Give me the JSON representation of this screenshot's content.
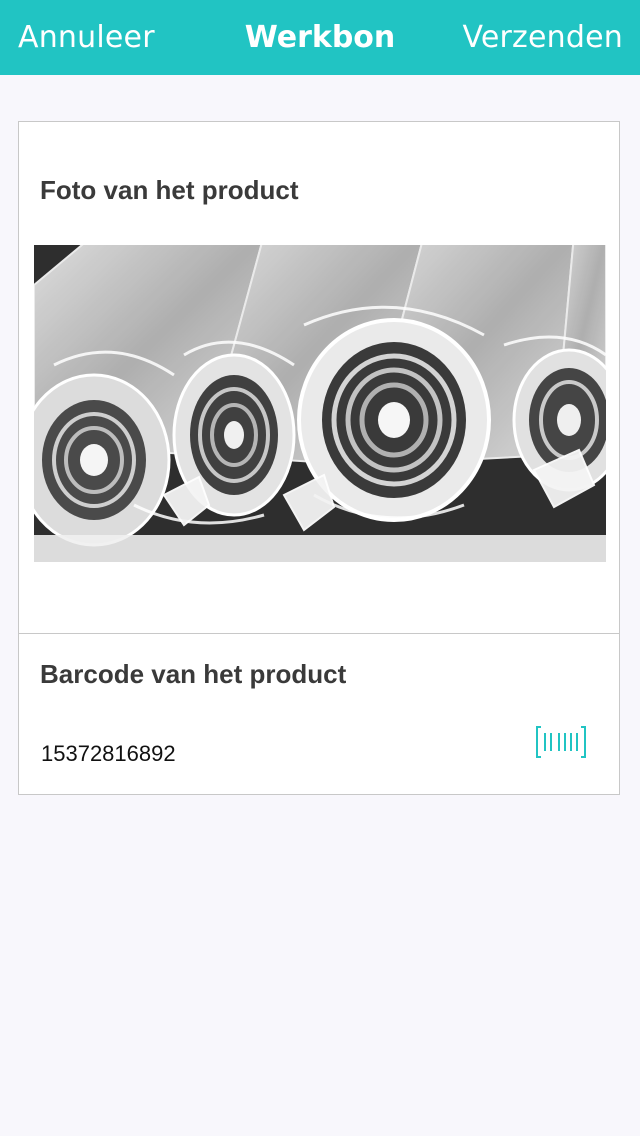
{
  "navbar": {
    "cancel_label": "Annuleer",
    "title": "Werkbon",
    "send_label": "Verzenden",
    "background_color": "#21C4C3"
  },
  "photo_section": {
    "title": "Foto van het product",
    "image_description": "barcode-scan-icon"
  },
  "barcode_section": {
    "title": "Barcode van het product",
    "value": "15372816892",
    "scan_icon": "barcode-scan-icon",
    "icon_color": "#21C4C3"
  }
}
